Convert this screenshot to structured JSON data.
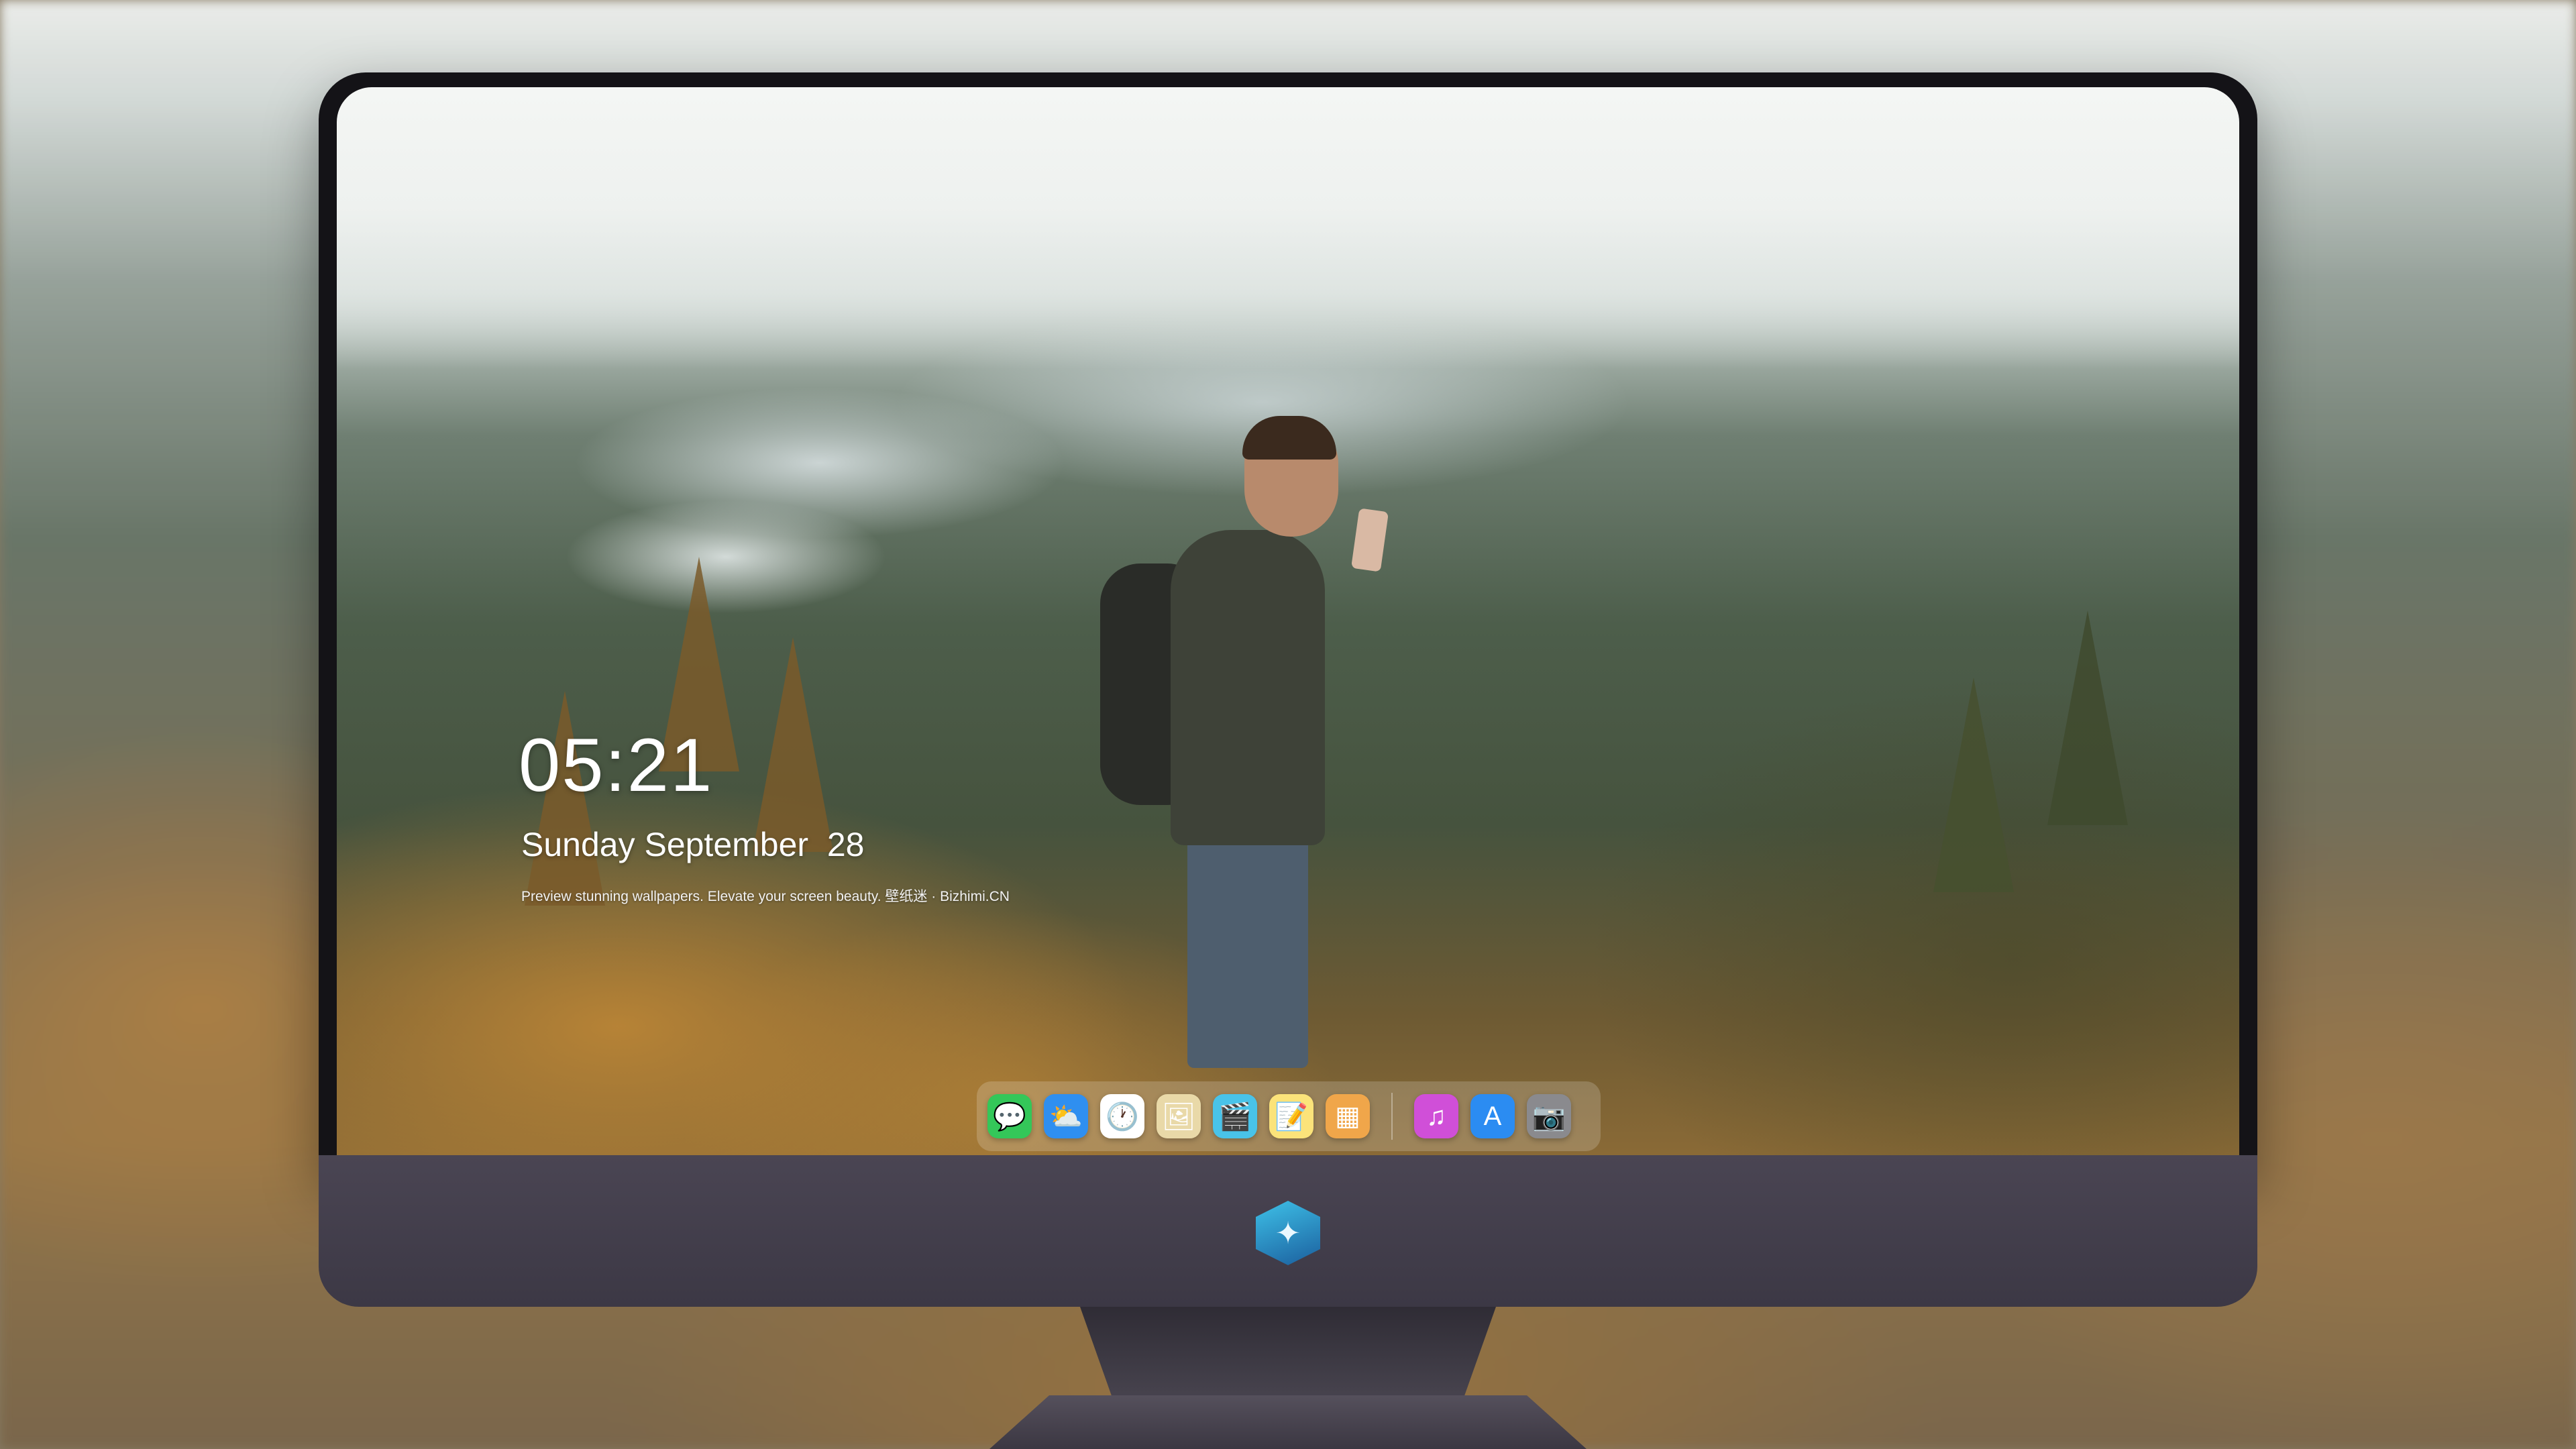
{
  "lock_screen": {
    "time": "05:21",
    "date": "Sunday September  28",
    "caption": "Preview stunning wallpapers. Elevate your screen beauty. 壁纸迷 · Bizhimi.CN"
  },
  "dock": {
    "apps": [
      {
        "name": "messages-icon",
        "glyph": "💬",
        "color": "#34c759"
      },
      {
        "name": "weather-icon",
        "glyph": "⛅",
        "color": "#2f8ff0"
      },
      {
        "name": "clock-icon",
        "glyph": "🕐",
        "color": "#ffffff"
      },
      {
        "name": "preview-icon",
        "glyph": "🖼",
        "color": "#e9d9a8"
      },
      {
        "name": "clapper-icon",
        "glyph": "🎬",
        "color": "#49c3e9"
      },
      {
        "name": "notes-icon",
        "glyph": "📝",
        "color": "#fbe37a"
      },
      {
        "name": "photo-booth-icon",
        "glyph": "▦",
        "color": "#f0a64a"
      }
    ],
    "apps_right": [
      {
        "name": "itunes-icon",
        "glyph": "♫",
        "color": "#d04fd8"
      },
      {
        "name": "app-store-icon",
        "glyph": "A",
        "color": "#2b8cf2"
      },
      {
        "name": "camera-icon",
        "glyph": "📷",
        "color": "#8a8a8e"
      }
    ]
  }
}
